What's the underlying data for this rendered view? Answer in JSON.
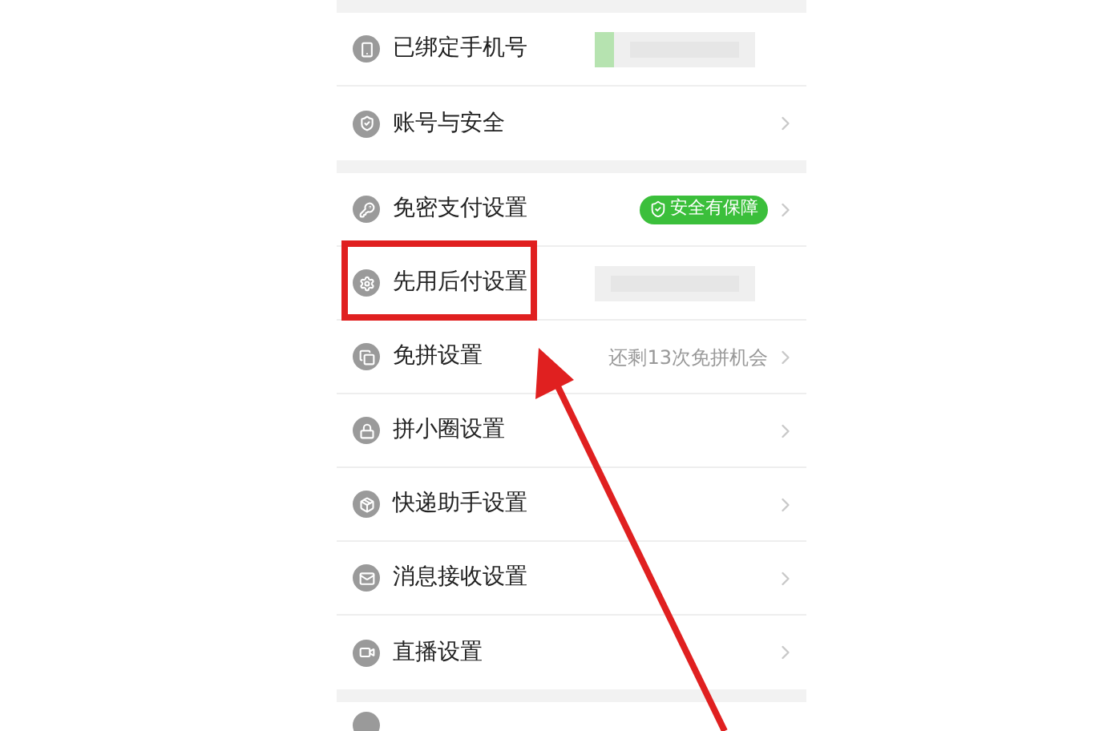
{
  "sections": [
    {
      "rows": [
        {
          "label": "已绑定手机号",
          "kind": "blurred",
          "tint": true,
          "chevron": false
        },
        {
          "label": "账号与安全",
          "kind": "plain",
          "chevron": true
        }
      ]
    },
    {
      "rows": [
        {
          "label": "免密支付设置",
          "kind": "badge",
          "badge": "安全有保障",
          "chevron": true
        },
        {
          "label": "先用后付设置",
          "kind": "blurred",
          "tint": false,
          "chevron": false
        },
        {
          "label": "免拼设置",
          "kind": "note",
          "note": "还剩13次免拼机会",
          "chevron": true
        },
        {
          "label": "拼小圈设置",
          "kind": "plain",
          "chevron": true
        },
        {
          "label": "快递助手设置",
          "kind": "plain",
          "chevron": true
        },
        {
          "label": "消息接收设置",
          "kind": "plain",
          "chevron": true
        },
        {
          "label": "直播设置",
          "kind": "plain",
          "chevron": true
        }
      ]
    }
  ],
  "annotations": {
    "highlight_box": true,
    "arrow": true
  }
}
